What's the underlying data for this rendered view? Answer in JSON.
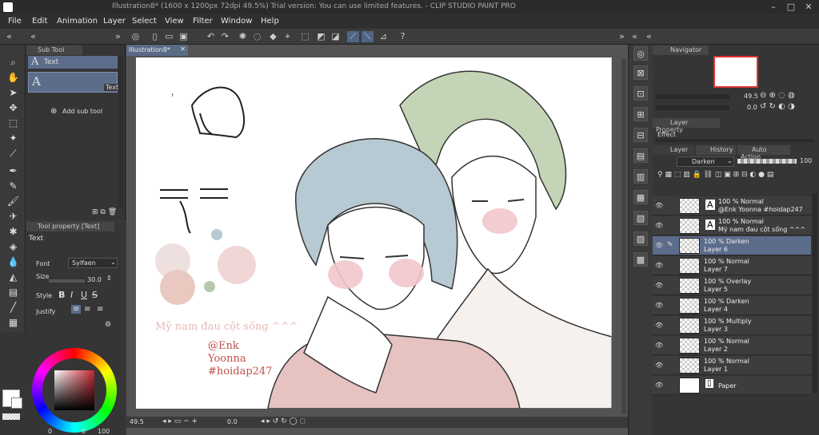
{
  "window": {
    "title": "Illustration8* (1600 x 1200px 72dpi 49.5%)  Trial version: You can use limited features. - CLIP STUDIO PAINT PRO"
  },
  "menu": [
    "File",
    "Edit",
    "Animation",
    "Layer",
    "Select",
    "View",
    "Filter",
    "Window",
    "Help"
  ],
  "subtool": {
    "tab": "Sub Tool",
    "items": [
      {
        "label": "Text"
      },
      {
        "label": "Text"
      }
    ],
    "add_label": "Add sub tool"
  },
  "toolprop": {
    "tab": "Tool property [Text]",
    "name": "Text",
    "font_label": "Font",
    "font_value": "Sylfaen",
    "size_label": "Size",
    "size_value": "30.0",
    "style_label": "Style",
    "justify_label": "Justify"
  },
  "document": {
    "tab": "Illustration8*",
    "zoom": "49.5",
    "rotation": "0.0",
    "canvas_texts": {
      "caption": "Mỹ nam đau cột sống ^^^",
      "tag1": "@Enk",
      "tag2": "Yoonna",
      "tag3": "#hoidap247"
    }
  },
  "navigator": {
    "tab": "Navigator",
    "zoom": "49.5",
    "rotation": "0.0"
  },
  "layer_property": {
    "tab": "Layer Property",
    "effect_label": "Effect"
  },
  "layers_panel": {
    "tabs": [
      "Layer",
      "History",
      "Auto Action"
    ],
    "blend_mode": "Darken",
    "opacity": "100",
    "layers": [
      {
        "mode": "100 % Normal",
        "name": "@Enk Yoonna #hoidap247",
        "type": "text"
      },
      {
        "mode": "100 % Normal",
        "name": "Mỹ nam đau cột sống ^^^",
        "type": "text"
      },
      {
        "mode": "100 % Darken",
        "name": "Layer 6",
        "type": "raster"
      },
      {
        "mode": "100 % Normal",
        "name": "Layer 7",
        "type": "raster"
      },
      {
        "mode": "100 % Overlay",
        "name": "Layer 5",
        "type": "raster"
      },
      {
        "mode": "100 % Darken",
        "name": "Layer 4",
        "type": "raster"
      },
      {
        "mode": "100 % Multiply",
        "name": "Layer 3",
        "type": "raster"
      },
      {
        "mode": "100 % Normal",
        "name": "Layer 2",
        "type": "raster"
      },
      {
        "mode": "100 % Normal",
        "name": "Layer 1",
        "type": "raster"
      },
      {
        "mode": "",
        "name": "Paper",
        "type": "paper"
      }
    ]
  },
  "color": {
    "main": "#ffffff",
    "sub": "#ffffff",
    "hue_selector": "#e8e8e8",
    "opacity_a": "0",
    "opacity_b": "0",
    "opacity_c": "100"
  },
  "colors": {
    "accent": "#5c6d8c",
    "hair_blue": "#b7c9d2",
    "hair_green": "#c4d4b6",
    "skin_pink": "#e8b4b8",
    "shirt_pink": "#e6c2c0",
    "text_red": "#c0504d"
  }
}
